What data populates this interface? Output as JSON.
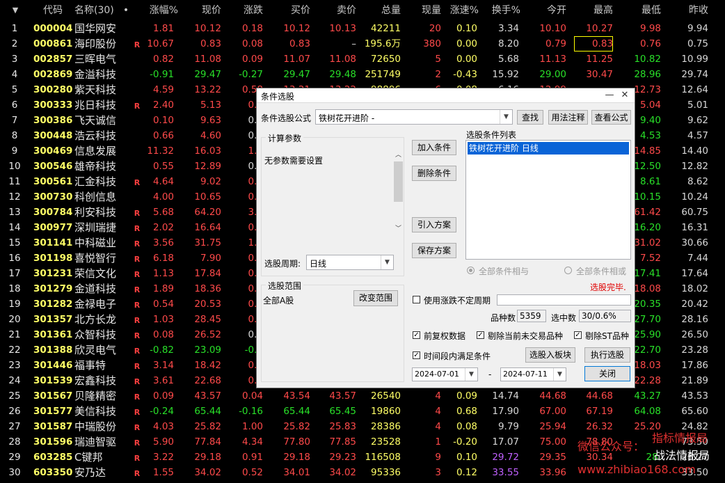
{
  "columns": [
    "代码",
    "名称(30)",
    "•",
    "涨幅%",
    "现价",
    "涨跌",
    "买价",
    "卖价",
    "总量",
    "现量",
    "涨速%",
    "换手%",
    "今开",
    "最高",
    "最低",
    "昨收"
  ],
  "rows": [
    [
      "1",
      "000004",
      "国华网安",
      "",
      "1.81",
      "10.12",
      "0.18",
      "10.12",
      "10.13",
      "42211",
      "20",
      "0.10",
      "3.34",
      "10.10",
      "10.27",
      "9.98",
      "9.94"
    ],
    [
      "2",
      "000861",
      "海印股份",
      "R",
      "10.67",
      "0.83",
      "0.08",
      "0.83",
      "–",
      "195.6万",
      "380",
      "0.00",
      "8.20",
      "0.79",
      "0.83",
      "0.76",
      "0.75"
    ],
    [
      "3",
      "002857",
      "三晖电气",
      "",
      "0.82",
      "11.08",
      "0.09",
      "11.07",
      "11.08",
      "72650",
      "5",
      "0.00",
      "5.68",
      "11.13",
      "11.25",
      "10.82",
      "10.99"
    ],
    [
      "4",
      "002869",
      "金溢科技",
      "",
      "-0.91",
      "29.47",
      "-0.27",
      "29.47",
      "29.48",
      "251749",
      "2",
      "-0.43",
      "15.92",
      "29.00",
      "30.47",
      "28.96",
      "29.74"
    ],
    [
      "5",
      "300280",
      "紫天科技",
      "",
      "4.59",
      "13.22",
      "0.58",
      "13.21",
      "13.22",
      "98896",
      "6",
      "0.08",
      "6.16",
      "12.99",
      "",
      "12.73",
      "12.64"
    ],
    [
      "6",
      "300333",
      "兆日科技",
      "R",
      "2.40",
      "5.13",
      "0.1",
      "",
      "",
      "",
      "",
      "",
      "",
      "",
      "",
      "5.04",
      "5.01"
    ],
    [
      "7",
      "300386",
      "飞天诚信",
      "",
      "0.10",
      "9.63",
      "0.0",
      "",
      "",
      "",
      "",
      "",
      "",
      "",
      "",
      "9.40",
      "9.62"
    ],
    [
      "8",
      "300448",
      "浩云科技",
      "",
      "0.66",
      "4.60",
      "0.0",
      "",
      "",
      "",
      "",
      "",
      "",
      "",
      "",
      "4.53",
      "4.57"
    ],
    [
      "9",
      "300469",
      "信息发展",
      "",
      "11.32",
      "16.03",
      "1.6",
      "",
      "",
      "",
      "",
      "",
      "",
      "",
      "",
      "14.85",
      "14.40"
    ],
    [
      "10",
      "300546",
      "雄帝科技",
      "",
      "0.55",
      "12.89",
      "0.0",
      "",
      "",
      "",
      "",
      "",
      "",
      "",
      "",
      "12.50",
      "12.82"
    ],
    [
      "11",
      "300561",
      "汇金科技",
      "R",
      "4.64",
      "9.02",
      "0.4",
      "",
      "",
      "",
      "",
      "",
      "",
      "",
      "",
      "8.61",
      "8.62"
    ],
    [
      "12",
      "300730",
      "科创信息",
      "",
      "4.00",
      "10.65",
      "0.4",
      "",
      "",
      "",
      "",
      "",
      "",
      "",
      "",
      "10.15",
      "10.24"
    ],
    [
      "13",
      "300784",
      "利安科技",
      "R",
      "5.68",
      "64.20",
      "3.4",
      "",
      "",
      "",
      "",
      "",
      "",
      "",
      "",
      "61.42",
      "60.75"
    ],
    [
      "14",
      "300977",
      "深圳瑞捷",
      "R",
      "2.02",
      "16.64",
      "0.3",
      "",
      "",
      "",
      "",
      "",
      "",
      "",
      "",
      "16.20",
      "16.31"
    ],
    [
      "15",
      "301141",
      "中科磁业",
      "R",
      "3.56",
      "31.75",
      "1.0",
      "",
      "",
      "",
      "",
      "",
      "",
      "",
      "",
      "31.02",
      "30.66"
    ],
    [
      "16",
      "301198",
      "喜悦智行",
      "R",
      "6.18",
      "7.90",
      "0.4",
      "",
      "",
      "",
      "",
      "",
      "",
      "",
      "",
      "7.52",
      "7.44"
    ],
    [
      "17",
      "301231",
      "荣信文化",
      "R",
      "1.13",
      "17.84",
      "0.2",
      "",
      "",
      "",
      "",
      "",
      "",
      "",
      "",
      "17.41",
      "17.64"
    ],
    [
      "18",
      "301279",
      "金道科技",
      "R",
      "1.89",
      "18.36",
      "0.3",
      "",
      "",
      "",
      "",
      "",
      "",
      "",
      "",
      "18.08",
      "18.02"
    ],
    [
      "19",
      "301282",
      "金禄电子",
      "R",
      "0.54",
      "20.53",
      "0.1",
      "",
      "",
      "",
      "",
      "",
      "",
      "",
      "",
      "20.35",
      "20.42"
    ],
    [
      "20",
      "301357",
      "北方长龙",
      "R",
      "1.03",
      "28.45",
      "0.2",
      "",
      "",
      "",
      "",
      "",
      "",
      "",
      "",
      "27.70",
      "28.16"
    ],
    [
      "21",
      "301361",
      "众智科技",
      "R",
      "0.08",
      "26.52",
      "0.0",
      "",
      "",
      "",
      "",
      "",
      "",
      "",
      "",
      "25.90",
      "26.50"
    ],
    [
      "22",
      "301388",
      "欣灵电气",
      "R",
      "-0.82",
      "23.09",
      "-0.1",
      "",
      "",
      "",
      "",
      "",
      "",
      "",
      "",
      "22.70",
      "23.28"
    ],
    [
      "23",
      "301446",
      "福事特",
      "R",
      "3.14",
      "18.42",
      "0.5",
      "",
      "",
      "",
      "",
      "",
      "",
      "",
      "",
      "18.03",
      "17.86"
    ],
    [
      "24",
      "301539",
      "宏鑫科技",
      "R",
      "3.61",
      "22.68",
      "0.7",
      "",
      "",
      "",
      "",
      "",
      "",
      "",
      "",
      "22.28",
      "21.89"
    ],
    [
      "25",
      "301567",
      "贝隆精密",
      "R",
      "0.09",
      "43.57",
      "0.04",
      "43.54",
      "43.57",
      "26540",
      "4",
      "0.09",
      "14.74",
      "44.68",
      "44.68",
      "43.27",
      "43.53"
    ],
    [
      "26",
      "301577",
      "美信科技",
      "R",
      "-0.24",
      "65.44",
      "-0.16",
      "65.44",
      "65.45",
      "19860",
      "4",
      "0.68",
      "17.90",
      "67.00",
      "67.19",
      "64.08",
      "65.60"
    ],
    [
      "27",
      "301587",
      "中瑞股份",
      "R",
      "4.03",
      "25.82",
      "1.00",
      "25.82",
      "25.83",
      "28386",
      "4",
      "0.08",
      "9.79",
      "25.94",
      "26.32",
      "25.20",
      "24.82"
    ],
    [
      "28",
      "301596",
      "瑞迪智驱",
      "R",
      "5.90",
      "77.84",
      "4.34",
      "77.80",
      "77.85",
      "23528",
      "1",
      "-0.20",
      "17.07",
      "75.00",
      "78.80",
      "",
      "73.50"
    ],
    [
      "29",
      "603285",
      "C键邦",
      "R",
      "3.22",
      "29.18",
      "0.91",
      "29.18",
      "29.23",
      "116508",
      "9",
      "0.10",
      "29.72",
      "29.35",
      "30.34",
      "28.",
      "28.27"
    ],
    [
      "30",
      "603350",
      "安乃达",
      "R",
      "1.55",
      "34.02",
      "0.52",
      "34.01",
      "34.02",
      "95336",
      "3",
      "0.12",
      "33.55",
      "33.96",
      "",
      "",
      "33.50"
    ]
  ],
  "dialog": {
    "title": "条件选股",
    "minimize": "—",
    "close": "✕",
    "formula_label": "条件选股公式",
    "formula_value": "铁树花开进阶  -",
    "find_btn": "查找",
    "usage_btn": "用法注释",
    "view_btn": "查看公式",
    "params_group": "计算参数",
    "params_text": "无参数需要设置",
    "period_label": "选股周期:",
    "period_value": "日线",
    "scope_group": "选股范围",
    "scope_value": "全部A股",
    "scope_btn": "改变范围",
    "add_btn": "加入条件",
    "del_btn": "删除条件",
    "import_btn": "引入方案",
    "save_btn": "保存方案",
    "list_label": "选股条件列表",
    "list_items": [
      "铁树花开进阶  日线"
    ],
    "and_label": "全部条件相与",
    "or_label": "全部条件相或",
    "status": "选股完毕.",
    "use_period_label": "使用涨跌不定周期",
    "count_label": "品种数",
    "count_value": "5359",
    "selected_label": "选中数",
    "selected_value": "30/0.6%",
    "adj_label": "前复权数据",
    "exclude_suspended_label": "剔除当前未交易品种",
    "exclude_st_label": "剔除ST品种",
    "time_range_label": "时间段内满足条件",
    "to_block_btn": "选股入板块",
    "run_btn": "执行选股",
    "date_from": "2024-07-01",
    "date_sep": "-",
    "date_to": "2024-07-11",
    "close_btn": "关闭"
  },
  "watermark": {
    "line1": "指标情报局",
    "line2": "微信公众号：",
    "line3": "战法情报局",
    "line4": "www.zhibiao168.com"
  }
}
